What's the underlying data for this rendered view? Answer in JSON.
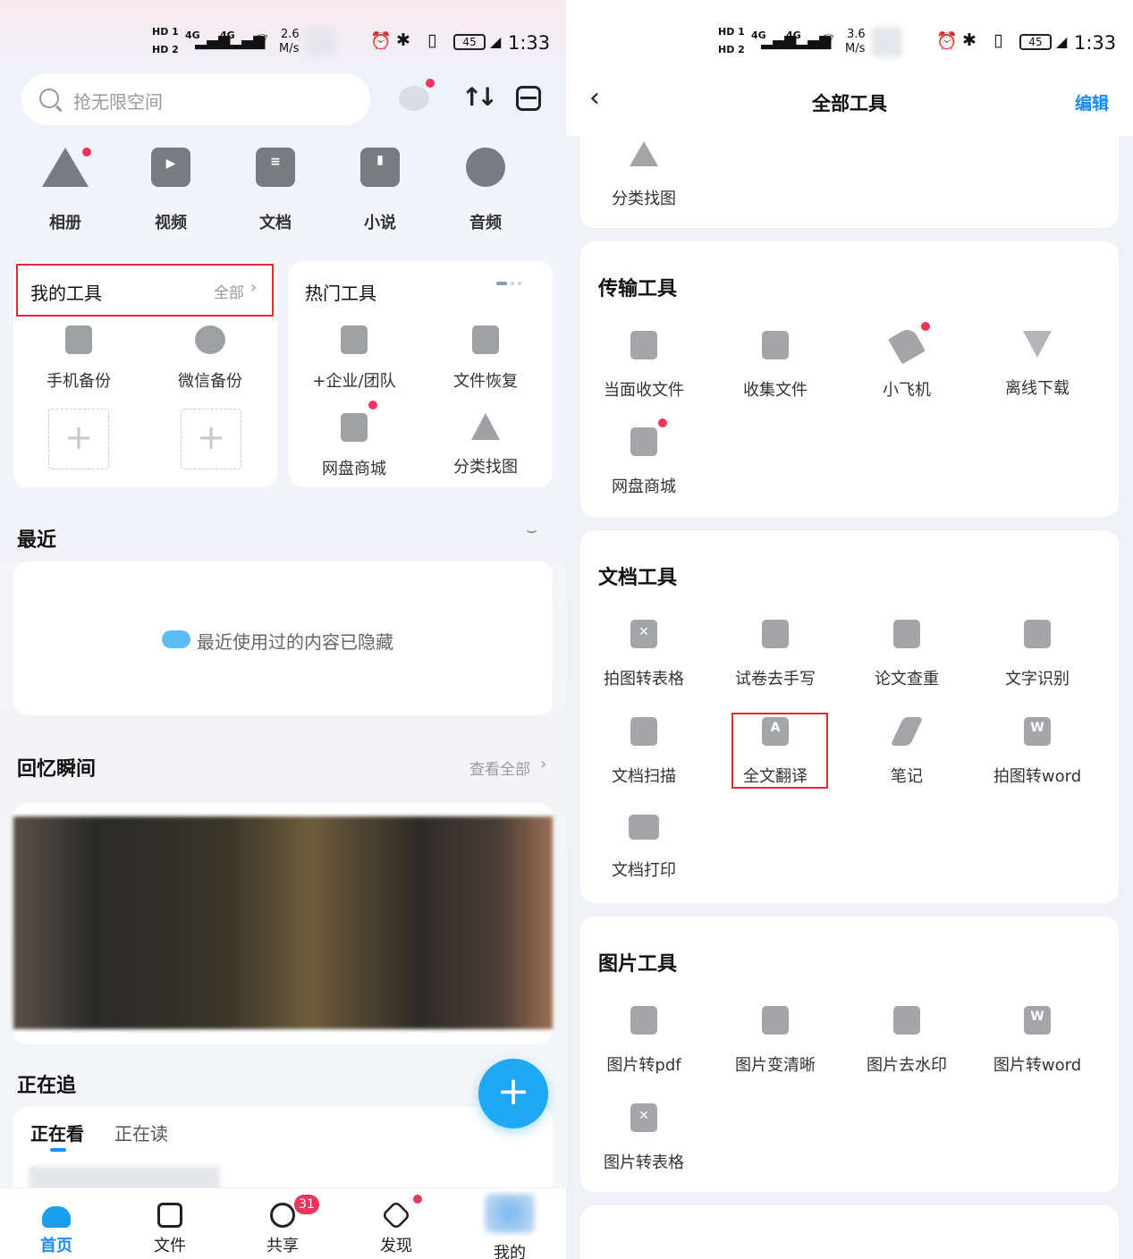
{
  "left": {
    "status": {
      "net_top": "HD 1",
      "net_bottom": "HD 2",
      "sig1": "4G",
      "sig2": "4G",
      "speed_val": "2.6",
      "speed_unit": "M/s",
      "battery": "45",
      "time": "1:33"
    },
    "search": {
      "placeholder": "抢无限空间"
    },
    "categories": [
      {
        "label": "相册",
        "icon": "album-icon"
      },
      {
        "label": "视频",
        "icon": "video-icon"
      },
      {
        "label": "文档",
        "icon": "document-icon"
      },
      {
        "label": "小说",
        "icon": "novel-icon"
      },
      {
        "label": "音频",
        "icon": "audio-icon"
      }
    ],
    "my_tools": {
      "title": "我的工具",
      "all_link": "全部",
      "items": [
        "手机备份",
        "微信备份"
      ]
    },
    "hot_tools": {
      "title": "热门工具",
      "items": [
        "+企业/团队",
        "文件恢复",
        "网盘商城",
        "分类找图"
      ]
    },
    "recent": {
      "title": "最近",
      "hidden_msg": "最近使用过的内容已隐藏"
    },
    "memories": {
      "title": "回忆瞬间",
      "view_all": "查看全部"
    },
    "following": {
      "title": "正在追",
      "tabs": [
        "正在看",
        "正在读"
      ]
    },
    "fab": "+",
    "nav": [
      {
        "label": "首页",
        "icon": "home-cloud-icon"
      },
      {
        "label": "文件",
        "icon": "folder-icon"
      },
      {
        "label": "共享",
        "icon": "share-icon",
        "badge": "31"
      },
      {
        "label": "发现",
        "icon": "discover-icon"
      },
      {
        "label": "我的",
        "icon": "avatar-icon"
      }
    ]
  },
  "right": {
    "status": {
      "net_top": "HD 1",
      "net_bottom": "HD 2",
      "sig1": "4G",
      "sig2": "4G",
      "speed_val": "3.6",
      "speed_unit": "M/s",
      "battery": "45",
      "time": "1:33"
    },
    "header": {
      "title": "全部工具",
      "edit": "编辑"
    },
    "top_partial": {
      "item": "分类找图"
    },
    "transfer": {
      "title": "传输工具",
      "items": [
        "当面收文件",
        "收集文件",
        "小飞机",
        "离线下载",
        "网盘商城"
      ]
    },
    "document": {
      "title": "文档工具",
      "items": [
        "拍图转表格",
        "试卷去手写",
        "论文查重",
        "文字识别",
        "文档扫描",
        "全文翻译",
        "笔记",
        "拍图转word",
        "文档打印"
      ]
    },
    "image": {
      "title": "图片工具",
      "items": [
        "图片转pdf",
        "图片变清晰",
        "图片去水印",
        "图片转word",
        "图片转表格"
      ]
    }
  },
  "colors": {
    "accent": "#1a8cff",
    "badge": "#f0345c",
    "highlight": "#e32b2b",
    "fab": "#1fa9f5"
  }
}
